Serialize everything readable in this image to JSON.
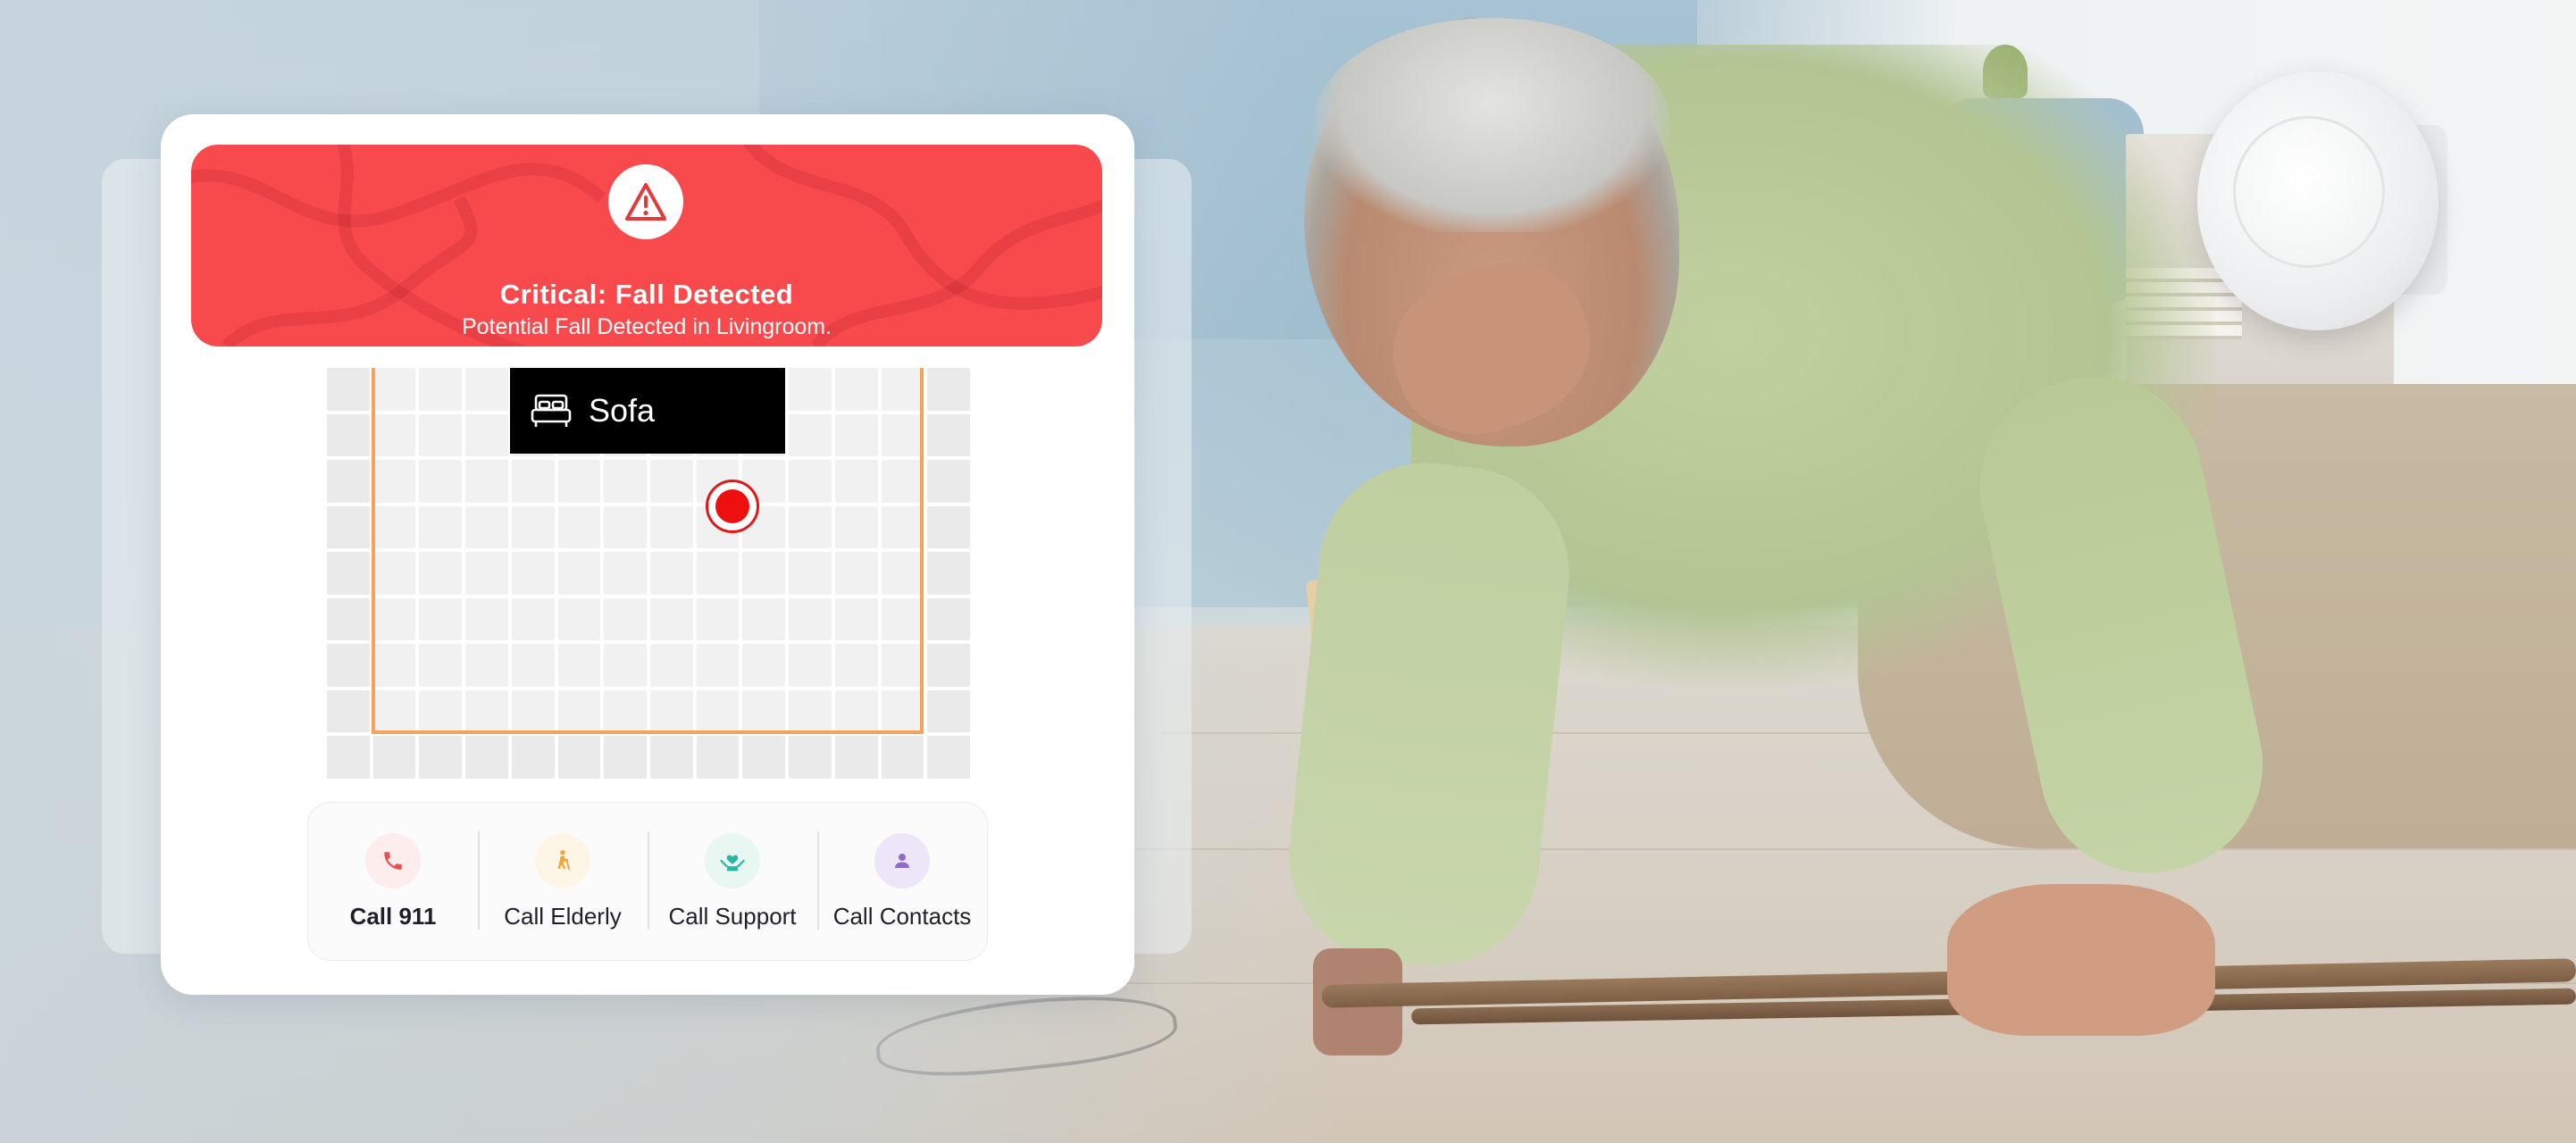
{
  "alert": {
    "title": "Critical: Fall Detected",
    "subtitle": "Potential Fall Detected in Livingroom.",
    "icon": "warning-triangle-icon",
    "color": "#f84a4d"
  },
  "floor_map": {
    "furniture_label": "Sofa",
    "furniture_icon": "bed-icon",
    "room_outline_color": "#f5a35c",
    "marker_color": "#ee0f0f"
  },
  "actions": [
    {
      "label": "Call 911",
      "icon": "phone-icon",
      "color": "#f04c4c",
      "bg": "#fdeeed"
    },
    {
      "label": "Call Elderly",
      "icon": "elderly-person-icon",
      "color": "#f2a33a",
      "bg": "#fdf6e6"
    },
    {
      "label": "Call Support",
      "icon": "heart-hands-icon",
      "color": "#2bb3a6",
      "bg": "#e9f7f3"
    },
    {
      "label": "Call Contacts",
      "icon": "user-icon",
      "color": "#8f6ad4",
      "bg": "#ede6f8"
    }
  ]
}
